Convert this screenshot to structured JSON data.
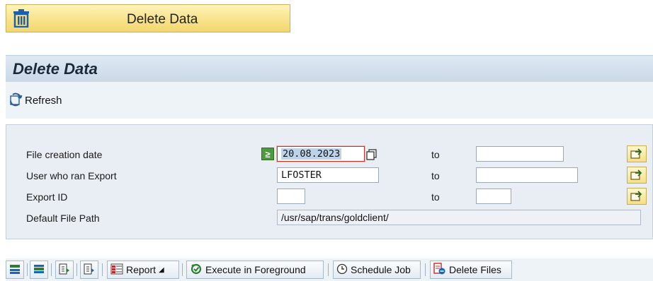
{
  "launcher": {
    "label": "Delete Data",
    "icon": "trash-icon"
  },
  "header": {
    "title": "Delete Data"
  },
  "toolbar": {
    "refresh_label": "Refresh"
  },
  "selection": {
    "rows": [
      {
        "label": "File creation date",
        "from": "20.08.2023",
        "to_label": "to",
        "to": ""
      },
      {
        "label": "User who ran Export",
        "from": "LFOSTER",
        "to_label": "to",
        "to": ""
      },
      {
        "label": "Export ID",
        "from": "",
        "to_label": "to",
        "to": ""
      },
      {
        "label": "Default File Path",
        "value": "/usr/sap/trans/goldclient/"
      }
    ],
    "required_indicator": "≥"
  },
  "app_toolbar": {
    "report_label": "Report",
    "execute_label": "Execute in Foreground",
    "schedule_label": "Schedule Job",
    "delete_files_label": "Delete Files"
  },
  "colors": {
    "accent": "#f6df84",
    "title_bg": "#dfe9f3",
    "panel_bg": "#e9eef4",
    "selected_border": "#c0392b"
  }
}
